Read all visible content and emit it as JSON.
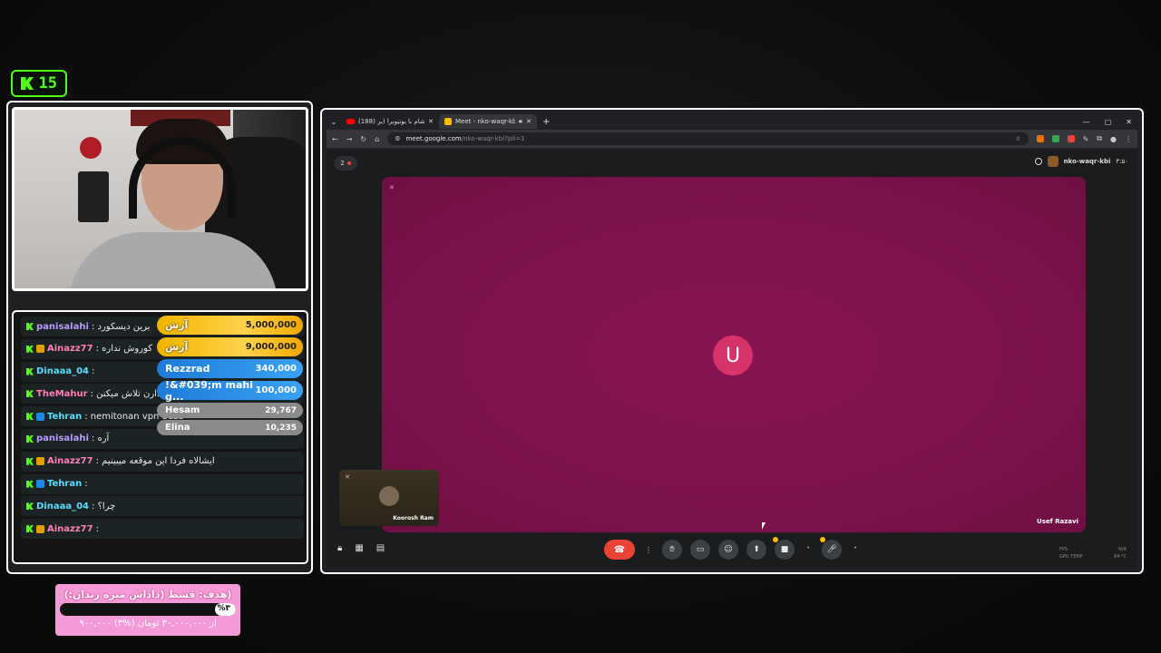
{
  "kick_badge": {
    "count": "15"
  },
  "chat": {
    "messages": [
      {
        "user": "panisalahi",
        "user_color": "#b89cff",
        "badge": "none",
        "text": ": برین دیسکورد"
      },
      {
        "user": "Ainazz77",
        "user_color": "#ff7eb6",
        "badge": "crown",
        "text": ": کوروش نداره"
      },
      {
        "user": "Dinaaa_04",
        "user_color": "#53e0ff",
        "badge": "none",
        "text": ":"
      },
      {
        "user": "TheMahur",
        "user_color": "#ff7eb6",
        "badge": "none",
        "text": ": سخت دارن تلاش میکنن"
      },
      {
        "user": "Tehran",
        "user_color": "#53e0ff",
        "badge": "mod",
        "text": ": nemitonan vpn beza"
      },
      {
        "user": "panisalahi",
        "user_color": "#b89cff",
        "badge": "none",
        "text": ": آره"
      },
      {
        "user": "Ainazz77",
        "user_color": "#ff7eb6",
        "badge": "crown",
        "text": ": ایشالاه فردا این موقعه میبینیم"
      },
      {
        "user": "Tehran",
        "user_color": "#53e0ff",
        "badge": "mod",
        "text": ":"
      },
      {
        "user": "Dinaaa_04",
        "user_color": "#53e0ff",
        "badge": "none",
        "text": ": چرا؟"
      },
      {
        "user": "Ainazz77",
        "user_color": "#ff7eb6",
        "badge": "crown",
        "text": ":"
      }
    ]
  },
  "donors": [
    {
      "name": "آرش",
      "amount": "5,000,000",
      "tier": "gold"
    },
    {
      "name": "آرش",
      "amount": "9,000,000",
      "tier": "gold"
    },
    {
      "name": "Rezzrad",
      "amount": "340,000",
      "tier": "blue"
    },
    {
      "name": "!&#039;m mahi g...",
      "amount": "100,000",
      "tier": "blue"
    },
    {
      "name": "Hesam",
      "amount": "29,767",
      "tier": "gray"
    },
    {
      "name": "Elina",
      "amount": "10,235",
      "tier": "gray"
    }
  ],
  "goal": {
    "title": "هدف: قسط (داداش میره زندان:))",
    "percent_label": "%۳",
    "progress_fraction": 0.03,
    "subtitle": "۹۰۰,۰۰۰ از ۳۰,۰۰۰,۰۰۰ تومان (%۳)"
  },
  "browser": {
    "tabs": [
      {
        "title": "(188) بفرمایید: شام با یوتیوبرا (بر...",
        "favicon": "youtube-icon",
        "active": false
      },
      {
        "title": "Meet - nko-waqr-kbi",
        "favicon": "meet-icon",
        "active": true
      }
    ],
    "new_tab": "+",
    "url_host": "meet.google.com",
    "url_path": "/nko-waqr-kbi?pli=1"
  },
  "meet": {
    "participant_count": "2",
    "meeting_code": "nko-waqr-kbi",
    "clock": "۳:۵۰",
    "main_participant": {
      "initial": "U",
      "name": "Usef Razavi",
      "avatar_color": "#d6336c"
    },
    "self_participant": {
      "name": "Koorosh Ram"
    },
    "stats": [
      {
        "label": "FPS",
        "value": "N/A"
      },
      {
        "label": "GPU TEMP",
        "value": "84 °C"
      }
    ]
  },
  "colors": {
    "kick_green": "#53fc18",
    "hangup_red": "#ea4335",
    "meet_tile": "#861452"
  }
}
